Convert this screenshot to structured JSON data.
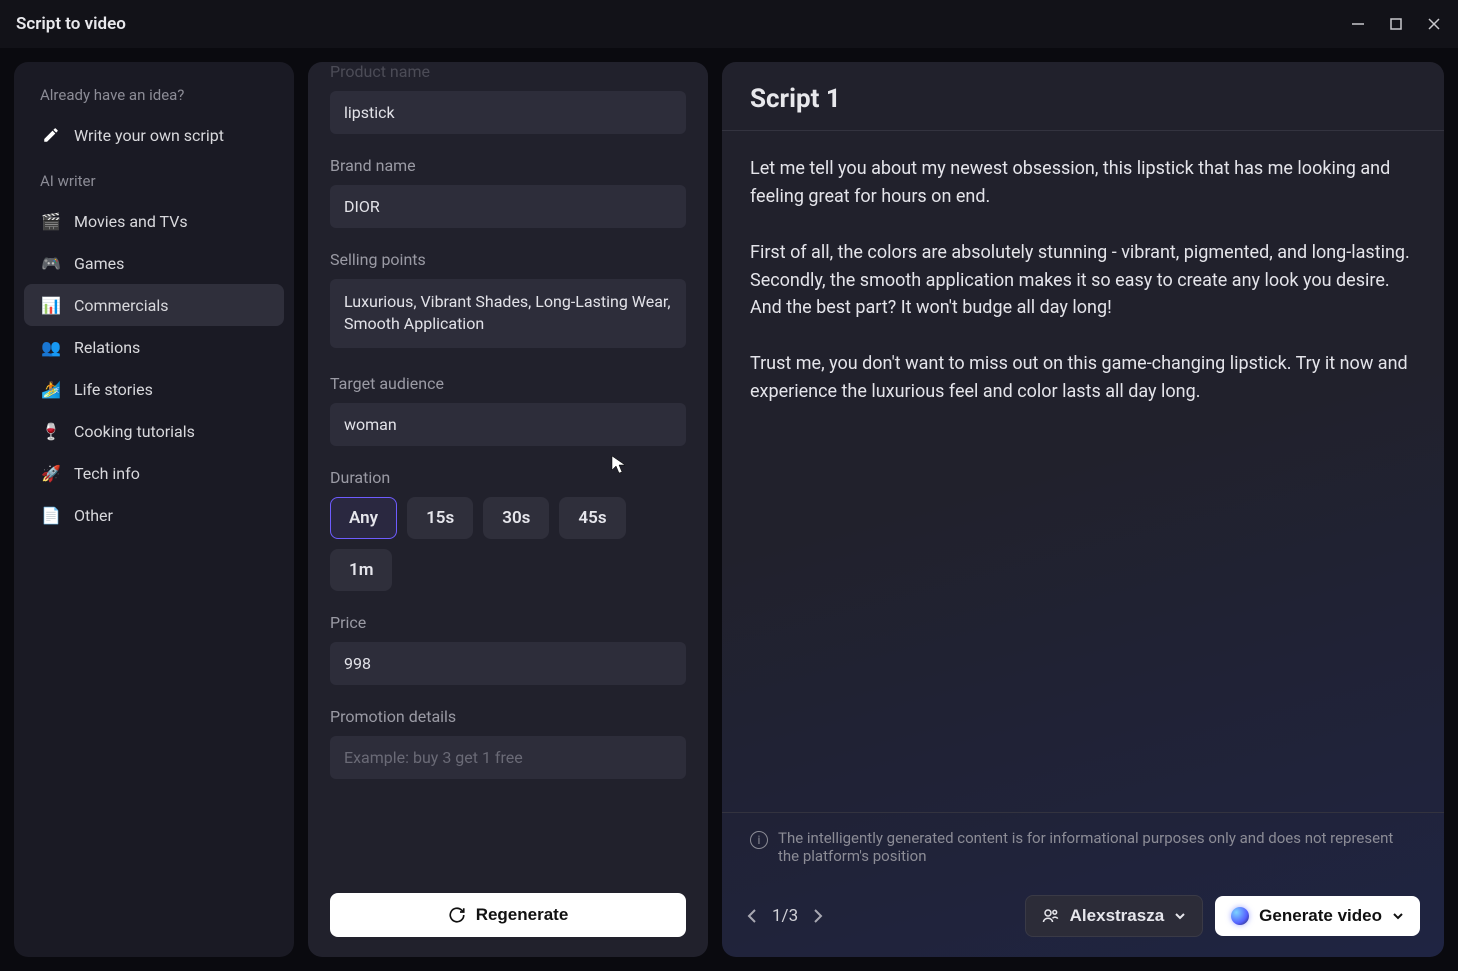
{
  "window": {
    "title": "Script to video"
  },
  "sidebar": {
    "idea_label": "Already have an idea?",
    "write_own": "Write your own script",
    "ai_writer_label": "AI writer",
    "items": [
      {
        "label": "Movies and TVs",
        "icon": "🎬"
      },
      {
        "label": "Games",
        "icon": "🎮"
      },
      {
        "label": "Commercials",
        "icon": "📊",
        "active": true
      },
      {
        "label": "Relations",
        "icon": "👥"
      },
      {
        "label": "Life stories",
        "icon": "🏄"
      },
      {
        "label": "Cooking tutorials",
        "icon": "🍷"
      },
      {
        "label": "Tech info",
        "icon": "🚀"
      },
      {
        "label": "Other",
        "icon": "📄"
      }
    ]
  },
  "form": {
    "product_name_label": "Product name",
    "product_name": "lipstick",
    "brand_name_label": "Brand name",
    "brand_name": "DIOR",
    "selling_points_label": "Selling points",
    "selling_points": "Luxurious, Vibrant Shades, Long-Lasting Wear, Smooth Application",
    "target_audience_label": "Target audience",
    "target_audience": "woman",
    "duration_label": "Duration",
    "duration_options": [
      "Any",
      "15s",
      "30s",
      "45s",
      "1m"
    ],
    "duration_selected": "Any",
    "price_label": "Price",
    "price": "998",
    "promo_label": "Promotion details",
    "promo_placeholder": "Example: buy 3 get 1 free",
    "regenerate_label": "Regenerate"
  },
  "script": {
    "title": "Script 1",
    "body": "Let me tell you about my newest obsession, this lipstick that has me looking and feeling great for hours on end.\n\nFirst of all, the colors are absolutely stunning - vibrant, pigmented, and long-lasting. Secondly, the smooth application makes it so easy to create any look you desire. And the best part? It won't budge all day long!\n\nTrust me, you don't want to miss out on this game-changing lipstick. Try it now and experience the luxurious feel and color lasts all day long.",
    "disclaimer": "The intelligently generated content is for informational purposes only and does not represent the platform's position",
    "page_current": 1,
    "page_total": 3,
    "page_display": "1/3",
    "user_label": "Alexstrasza",
    "generate_label": "Generate video"
  }
}
